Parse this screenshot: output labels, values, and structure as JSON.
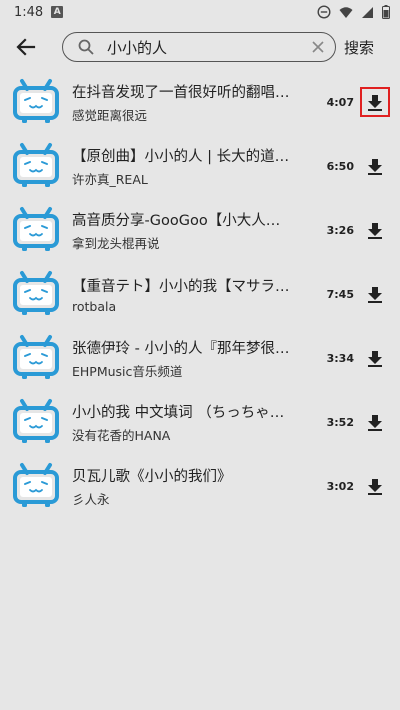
{
  "status": {
    "time": "1:48",
    "a_badge": "A"
  },
  "toolbar": {
    "search_value": "小小的人",
    "search_button": "搜索"
  },
  "colors": {
    "thumb_blue": "#2a9ad6",
    "highlight_red": "#e02020"
  },
  "results": [
    {
      "title": "在抖音发现了一首很好听的翻唱…",
      "artist": "感觉距离很远",
      "duration": "4:07"
    },
    {
      "title": "【原创曲】小小的人 | 长大的道…",
      "artist": "许亦真_REAL",
      "duration": "6:50"
    },
    {
      "title": "高音质分享-GooGoo【小大人】“…",
      "artist": "拿到龙头棍再说",
      "duration": "3:26"
    },
    {
      "title": "【重音テト】小小的我【マサラ…",
      "artist": "rotbala",
      "duration": "7:45"
    },
    {
      "title": "张德伊玲 - 小小的人『那年梦很…",
      "artist": "EHPMusic音乐频道",
      "duration": "3:34"
    },
    {
      "title": "小小的我 中文填词 （ちっちゃ…",
      "artist": "没有花香的HANA",
      "duration": "3:52"
    },
    {
      "title": "贝瓦儿歌《小小的我们》",
      "artist": "彡人永",
      "duration": "3:02"
    }
  ]
}
